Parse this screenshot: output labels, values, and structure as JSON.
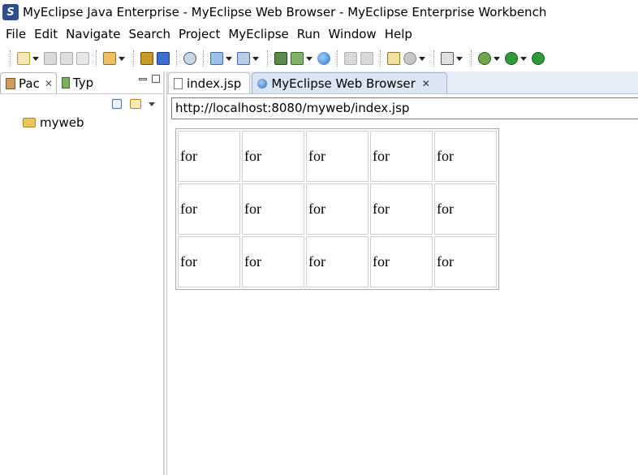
{
  "window": {
    "title": "MyEclipse Java Enterprise - MyEclipse Web Browser - MyEclipse Enterprise Workbench"
  },
  "menu": [
    "File",
    "Edit",
    "Navigate",
    "Search",
    "Project",
    "MyEclipse",
    "Run",
    "Window",
    "Help"
  ],
  "left_view": {
    "tabs": [
      {
        "label": "Pac",
        "icon": "package-explorer-icon",
        "active": true
      },
      {
        "label": "Typ",
        "icon": "type-hierarchy-icon",
        "active": false
      }
    ],
    "tree": [
      {
        "label": "myweb",
        "icon": "web-project-folder-icon"
      }
    ]
  },
  "editor": {
    "tabs": [
      {
        "label": "index.jsp",
        "icon": "jsp-file-icon",
        "active": false
      },
      {
        "label": "MyEclipse Web Browser",
        "icon": "globe-icon",
        "active": true
      }
    ],
    "url": "http://localhost:8080/myweb/index.jsp",
    "table": {
      "rows": [
        [
          "for",
          "for",
          "for",
          "for",
          "for"
        ],
        [
          "for",
          "for",
          "for",
          "for",
          "for"
        ],
        [
          "for",
          "for",
          "for",
          "for",
          "for"
        ]
      ]
    }
  },
  "colors": {
    "tab_active_bg": "#dbe5f3",
    "tab_strip_bg": "#e6ecf5",
    "app_icon_bg": "#2b4f8a"
  }
}
